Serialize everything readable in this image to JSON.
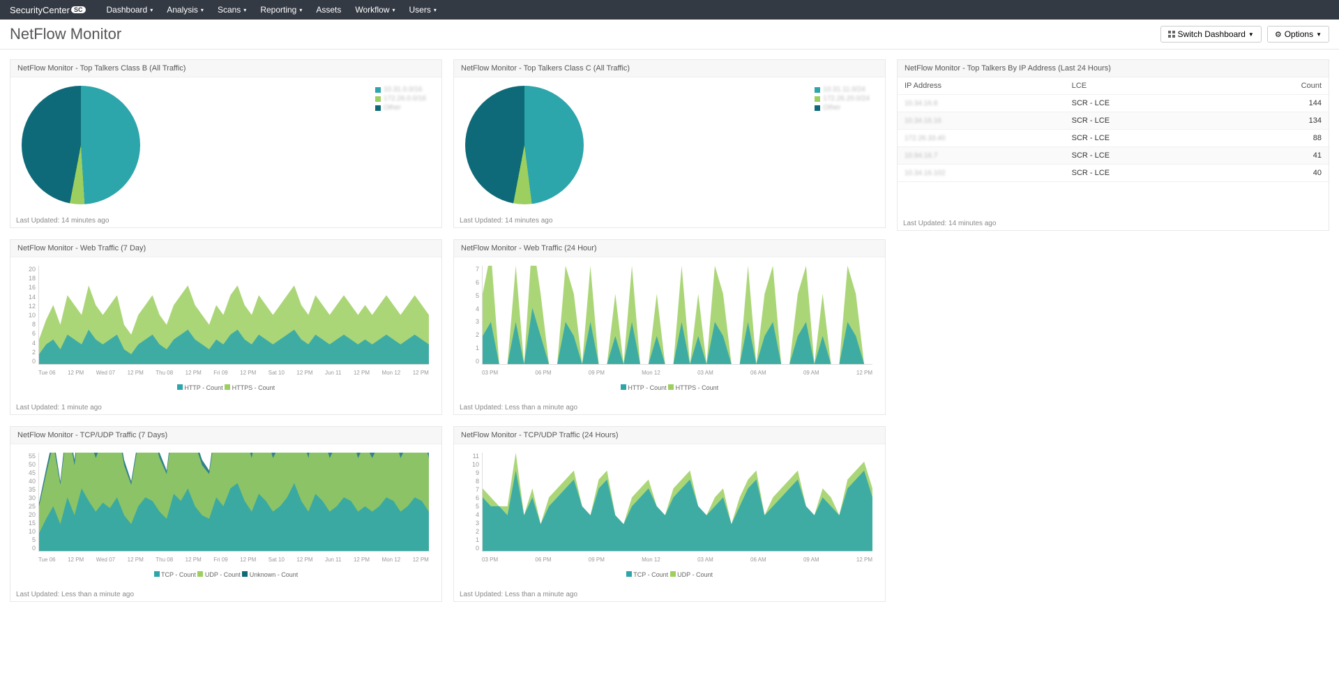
{
  "brand": "SecurityCenter",
  "nav": [
    "Dashboard",
    "Analysis",
    "Scans",
    "Reporting",
    "Assets",
    "Workflow",
    "Users"
  ],
  "nav_dropdown": [
    true,
    true,
    true,
    true,
    false,
    true,
    true
  ],
  "page_title": "NetFlow Monitor",
  "buttons": {
    "switch": "Switch Dashboard",
    "options": "Options"
  },
  "colors": {
    "teal": "#2ca5ab",
    "darkteal": "#0e6a78",
    "green": "#9ccf5f",
    "darkgreen": "#6aa035"
  },
  "panels": {
    "pieB": {
      "title": "NetFlow Monitor - Top Talkers Class B (All Traffic)",
      "footer": "Last Updated: 14 minutes ago",
      "legend": [
        "10.31.0.0/16",
        "172.26.0.0/16",
        "Other"
      ]
    },
    "pieC": {
      "title": "NetFlow Monitor - Top Talkers Class C (All Traffic)",
      "footer": "Last Updated: 14 minutes ago",
      "legend": [
        "10.31.11.0/24",
        "172.26.20.0/24",
        "Other"
      ]
    },
    "topIP": {
      "title": "NetFlow Monitor - Top Talkers By IP Address (Last 24 Hours)",
      "footer": "Last Updated: 14 minutes ago",
      "columns": [
        "IP Address",
        "LCE",
        "Count"
      ],
      "rows": [
        {
          "ip": "10.34.16.8",
          "lce": "SCR - LCE",
          "count": 144
        },
        {
          "ip": "10.34.16.16",
          "lce": "SCR - LCE",
          "count": 134
        },
        {
          "ip": "172.26.33.40",
          "lce": "SCR - LCE",
          "count": 88
        },
        {
          "ip": "10.94.16.7",
          "lce": "SCR - LCE",
          "count": 41
        },
        {
          "ip": "10.34.16.102",
          "lce": "SCR - LCE",
          "count": 40
        }
      ]
    },
    "web7": {
      "title": "NetFlow Monitor - Web Traffic (7 Day)",
      "footer": "Last Updated: 1 minute ago",
      "legend": [
        "HTTP - Count",
        "HTTPS - Count"
      ]
    },
    "web24": {
      "title": "NetFlow Monitor - Web Traffic (24 Hour)",
      "footer": "Last Updated: Less than a minute ago",
      "legend": [
        "HTTP - Count",
        "HTTPS - Count"
      ]
    },
    "tcp7": {
      "title": "NetFlow Monitor - TCP/UDP Traffic (7 Days)",
      "footer": "Last Updated: Less than a minute ago",
      "legend": [
        "TCP - Count",
        "UDP - Count",
        "Unknown - Count"
      ]
    },
    "tcp24": {
      "title": "NetFlow Monitor - TCP/UDP Traffic (24 Hours)",
      "footer": "Last Updated: Less than a minute ago",
      "legend": [
        "TCP - Count",
        "UDP - Count"
      ]
    }
  },
  "chart_data": [
    {
      "id": "pieB",
      "type": "pie",
      "series": [
        {
          "name": "10.31.0.0/16",
          "value": 49,
          "color": "#2ca5ab"
        },
        {
          "name": "172.26.0.0/16",
          "value": 4,
          "color": "#9ccf5f"
        },
        {
          "name": "Other",
          "value": 47,
          "color": "#0e6a78"
        }
      ]
    },
    {
      "id": "pieC",
      "type": "pie",
      "series": [
        {
          "name": "10.31.11.0/24",
          "value": 48,
          "color": "#2ca5ab"
        },
        {
          "name": "172.26.20.0/24",
          "value": 5,
          "color": "#9ccf5f"
        },
        {
          "name": "Other",
          "value": 47,
          "color": "#0e6a78"
        }
      ]
    },
    {
      "id": "web7",
      "type": "area",
      "ylim": [
        0,
        20
      ],
      "yticks": [
        0,
        2,
        4,
        6,
        8,
        10,
        12,
        14,
        16,
        18,
        20
      ],
      "x": [
        "Tue 06",
        "12 PM",
        "Wed 07",
        "12 PM",
        "Thu 08",
        "12 PM",
        "Fri 09",
        "12 PM",
        "Sat 10",
        "12 PM",
        "Jun 11",
        "12 PM",
        "Mon 12",
        "12 PM"
      ],
      "series": [
        {
          "name": "HTTP - Count",
          "color": "#2ca5ab",
          "values": [
            2,
            4,
            5,
            3,
            6,
            5,
            4,
            7,
            5,
            4,
            5,
            6,
            3,
            2,
            4,
            5,
            6,
            4,
            3,
            5,
            6,
            7,
            5,
            4,
            3,
            5,
            4,
            6,
            7,
            5,
            4,
            6,
            5,
            4,
            5,
            6,
            7,
            5,
            4,
            6,
            5,
            4,
            5,
            6,
            5,
            4,
            5,
            4,
            5,
            6,
            5,
            4,
            5,
            6,
            5,
            4
          ]
        },
        {
          "name": "HTTPS - Count",
          "color": "#9ccf5f",
          "values": [
            3,
            5,
            7,
            5,
            8,
            7,
            6,
            9,
            7,
            6,
            7,
            8,
            5,
            4,
            6,
            7,
            8,
            6,
            5,
            7,
            8,
            9,
            7,
            6,
            5,
            7,
            6,
            8,
            9,
            7,
            6,
            8,
            7,
            6,
            7,
            8,
            9,
            7,
            6,
            8,
            7,
            6,
            7,
            8,
            7,
            6,
            7,
            6,
            7,
            8,
            7,
            6,
            7,
            8,
            7,
            6
          ]
        }
      ]
    },
    {
      "id": "web24",
      "type": "area",
      "ylim": [
        0,
        7
      ],
      "yticks": [
        0,
        1,
        2,
        3,
        4,
        5,
        6,
        7
      ],
      "x": [
        "03 PM",
        "06 PM",
        "09 PM",
        "Mon 12",
        "03 AM",
        "06 AM",
        "09 AM",
        "12 PM"
      ],
      "series": [
        {
          "name": "HTTP - Count",
          "color": "#2ca5ab",
          "values": [
            2,
            3,
            0,
            0,
            3,
            0,
            4,
            2,
            0,
            0,
            3,
            2,
            0,
            3,
            0,
            0,
            2,
            0,
            3,
            0,
            0,
            2,
            0,
            0,
            3,
            0,
            2,
            0,
            3,
            2,
            0,
            0,
            3,
            0,
            2,
            3,
            0,
            0,
            2,
            3,
            0,
            2,
            0,
            0,
            3,
            2,
            0,
            0
          ]
        },
        {
          "name": "HTTPS - Count",
          "color": "#9ccf5f",
          "values": [
            3,
            5,
            0,
            0,
            4,
            0,
            5,
            3,
            0,
            0,
            4,
            3,
            0,
            4,
            0,
            0,
            3,
            0,
            4,
            0,
            0,
            3,
            0,
            0,
            4,
            0,
            3,
            0,
            4,
            3,
            0,
            0,
            4,
            0,
            3,
            4,
            0,
            0,
            3,
            4,
            0,
            3,
            0,
            0,
            4,
            3,
            0,
            0
          ]
        }
      ]
    },
    {
      "id": "tcp7",
      "type": "area",
      "ylim": [
        0,
        55
      ],
      "yticks": [
        0,
        5,
        10,
        15,
        20,
        25,
        30,
        35,
        40,
        45,
        50,
        55
      ],
      "x": [
        "Tue 06",
        "12 PM",
        "Wed 07",
        "12 PM",
        "Thu 08",
        "12 PM",
        "Fri 09",
        "12 PM",
        "Sat 10",
        "12 PM",
        "Jun 11",
        "12 PM",
        "Mon 12",
        "12 PM"
      ],
      "series": [
        {
          "name": "TCP - Count",
          "color": "#2ca5ab",
          "values": [
            10,
            18,
            25,
            15,
            30,
            20,
            35,
            28,
            22,
            27,
            24,
            30,
            20,
            15,
            25,
            30,
            28,
            22,
            18,
            32,
            28,
            35,
            25,
            20,
            18,
            30,
            25,
            35,
            38,
            28,
            22,
            32,
            28,
            22,
            25,
            30,
            38,
            28,
            22,
            32,
            28,
            22,
            25,
            30,
            28,
            22,
            25,
            22,
            25,
            30,
            28,
            22,
            25,
            30,
            28,
            22
          ]
        },
        {
          "name": "UDP - Count",
          "color": "#9ccf5f",
          "values": [
            15,
            25,
            35,
            22,
            40,
            28,
            45,
            36,
            30,
            35,
            32,
            40,
            28,
            22,
            35,
            40,
            38,
            30,
            25,
            42,
            38,
            45,
            35,
            28,
            25,
            40,
            35,
            45,
            48,
            38,
            30,
            42,
            38,
            30,
            35,
            40,
            48,
            38,
            30,
            42,
            38,
            30,
            35,
            40,
            38,
            30,
            35,
            30,
            35,
            40,
            38,
            30,
            35,
            40,
            38,
            30
          ]
        },
        {
          "name": "Unknown - Count",
          "color": "#0e6a78",
          "values": [
            2,
            3,
            4,
            2,
            5,
            3,
            4,
            3,
            3,
            4,
            3,
            4,
            3,
            2,
            3,
            4,
            4,
            3,
            2,
            4,
            4,
            5,
            3,
            3,
            2,
            4,
            3,
            4,
            5,
            4,
            3,
            4,
            4,
            3,
            3,
            4,
            5,
            4,
            3,
            4,
            4,
            3,
            3,
            4,
            4,
            3,
            3,
            3,
            3,
            4,
            4,
            3,
            3,
            4,
            4,
            3
          ]
        }
      ]
    },
    {
      "id": "tcp24",
      "type": "area",
      "ylim": [
        0,
        11
      ],
      "yticks": [
        0,
        1,
        2,
        3,
        4,
        5,
        6,
        7,
        8,
        9,
        10,
        11
      ],
      "x": [
        "03 PM",
        "06 PM",
        "09 PM",
        "Mon 12",
        "03 AM",
        "06 AM",
        "09 AM",
        "12 PM"
      ],
      "series": [
        {
          "name": "TCP - Count",
          "color": "#2ca5ab",
          "values": [
            6,
            5,
            5,
            4,
            9,
            4,
            6,
            3,
            5,
            6,
            7,
            8,
            5,
            4,
            7,
            8,
            4,
            3,
            5,
            6,
            7,
            5,
            4,
            6,
            7,
            8,
            5,
            4,
            5,
            6,
            3,
            5,
            7,
            8,
            4,
            5,
            6,
            7,
            8,
            5,
            4,
            6,
            5,
            4,
            7,
            8,
            9,
            6
          ]
        },
        {
          "name": "UDP - Count",
          "color": "#9ccf5f",
          "values": [
            1,
            1,
            0,
            1,
            2,
            0,
            1,
            0,
            1,
            1,
            1,
            1,
            0,
            0,
            1,
            1,
            0,
            0,
            1,
            1,
            1,
            0,
            0,
            1,
            1,
            1,
            0,
            0,
            1,
            1,
            0,
            1,
            1,
            1,
            0,
            1,
            1,
            1,
            1,
            0,
            0,
            1,
            1,
            0,
            1,
            1,
            1,
            1
          ]
        }
      ]
    }
  ]
}
